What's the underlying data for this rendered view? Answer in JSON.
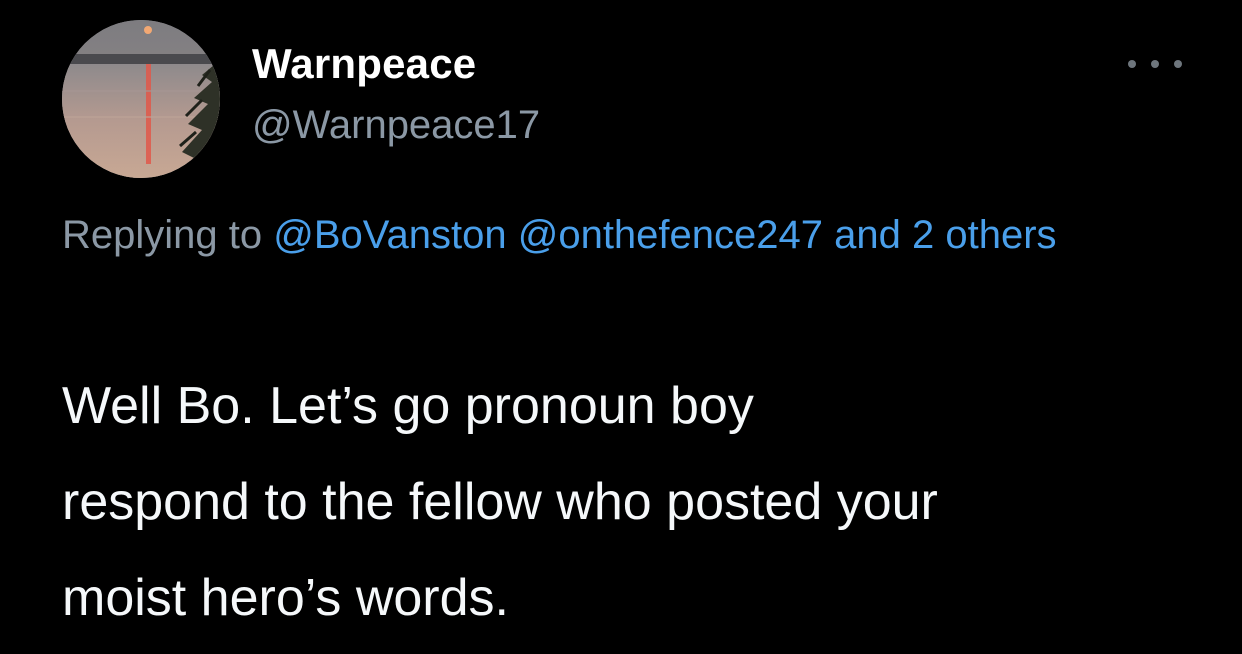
{
  "author": {
    "display_name": "Warnpeace",
    "handle": "@Warnpeace17",
    "avatar_icon": "sunset-lake-avatar"
  },
  "menu": {
    "icon": "more-horizontal-icon"
  },
  "reply": {
    "prefix": "Replying to",
    "mention_1": "@BoVanston",
    "mention_2": "@onthefence247",
    "others": "and 2 others"
  },
  "tweet": {
    "line_1": "Well Bo.  Let’s go pronoun boy",
    "line_2": "respond to the fellow who posted your",
    "line_3": "moist hero’s words."
  },
  "colors": {
    "background": "#000000",
    "name": "#ffffff",
    "secondary": "#8b98a5",
    "link": "#4a9fea"
  }
}
